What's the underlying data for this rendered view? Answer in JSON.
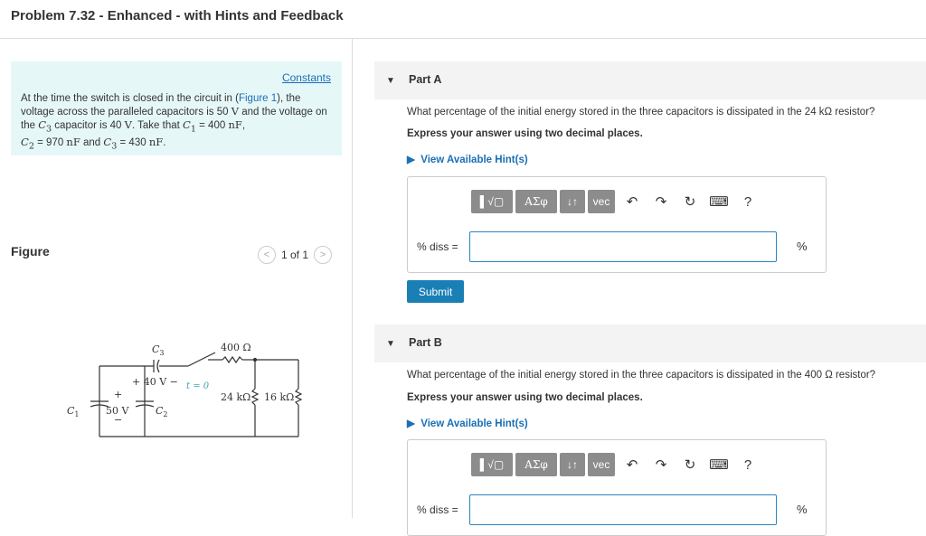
{
  "header": {
    "title": "Problem 7.32 - Enhanced - with Hints and Feedback"
  },
  "intro": {
    "constants": "Constants",
    "t1": "At the time the switch is closed in the circuit in (",
    "figure_link": "Figure 1",
    "t2": "), the voltage across the paralleled capacitors is 50 ",
    "v": "V",
    "t3": " and the voltage on the ",
    "c3": "C",
    "t4": " capacitor is 40 ",
    "t5": ". Take that ",
    "c1": "C",
    "t6": " = 400 ",
    "nf": "nF",
    "t7": ", ",
    "c2": "C",
    "t8": " = 970 ",
    "t9": " and ",
    "t10": " = 430 ",
    "t11": "."
  },
  "figure": {
    "label": "Figure",
    "pager": "1 of 1",
    "prev": "<",
    "next": ">",
    "circuit": {
      "c3": "C",
      "c3sub": "3",
      "r400": "400 Ω",
      "v40": "+ 40 V −",
      "t0": "t = 0",
      "r24": "24 kΩ",
      "r16": "16 kΩ",
      "plus": "+",
      "minus": "−",
      "c1": "C",
      "c1sub": "1",
      "v50": "50 V",
      "c2": "C",
      "c2sub": "2"
    }
  },
  "parts": [
    {
      "title": "Part A",
      "question": "What percentage of the initial energy stored in the three capacitors is dissipated in the 24 kΩ resistor?",
      "express": "Express your answer using two decimal places.",
      "hint": "View Available Hint(s)",
      "answer_label": "% diss =",
      "unit": "%",
      "submit": "Submit"
    },
    {
      "title": "Part B",
      "question": "What percentage of the initial energy stored in the three capacitors is dissipated in the 400 Ω resistor?",
      "express": "Express your answer using two decimal places.",
      "hint": "View Available Hint(s)",
      "answer_label": "% diss =",
      "unit": "%"
    }
  ],
  "toolbar": {
    "templates": "▌√▢",
    "greek": "ΑΣφ",
    "arrows": "↓↑",
    "vec": "vec",
    "undo": "↶",
    "redo": "↷",
    "reset": "↻",
    "keyboard": "⌨",
    "help": "?"
  }
}
